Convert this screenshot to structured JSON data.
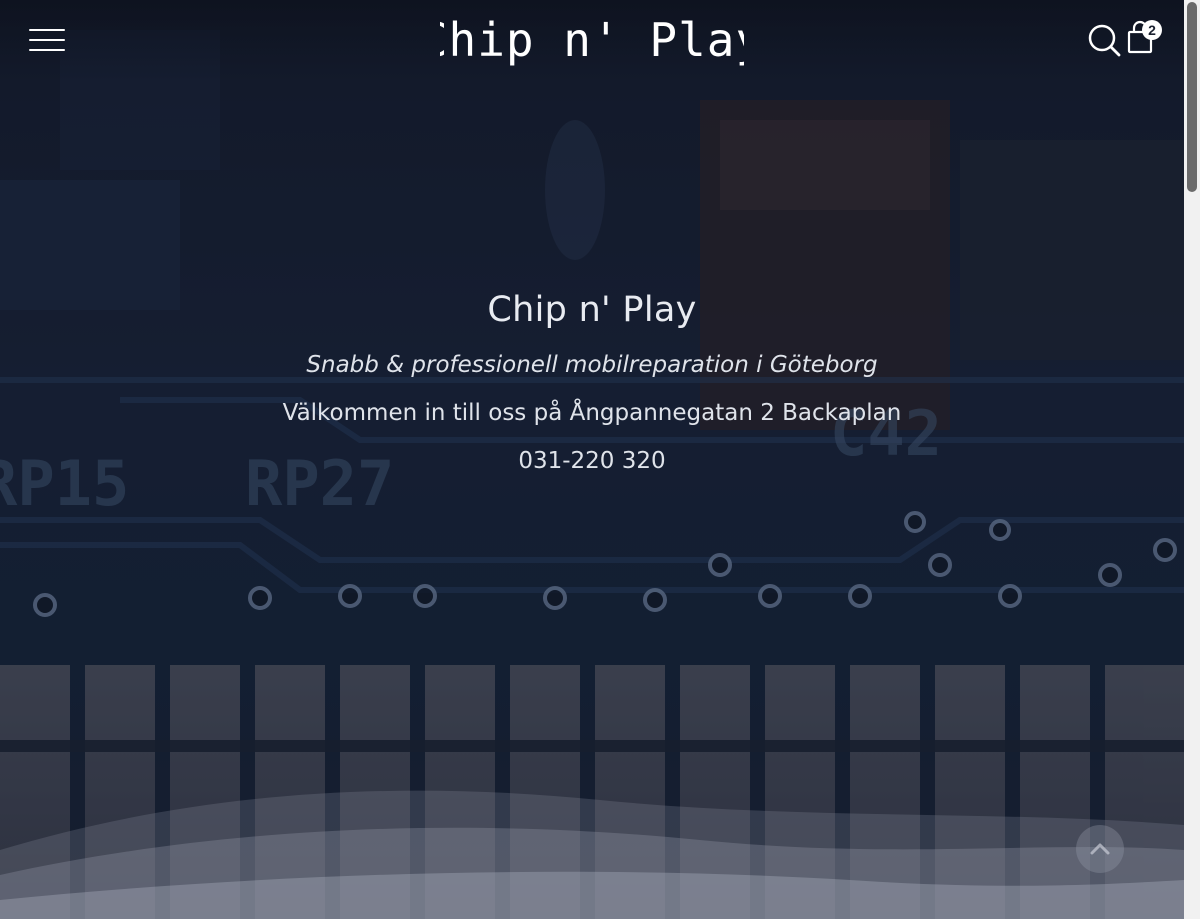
{
  "header": {
    "logo_text": "Chip n' Play",
    "cart_count": "2"
  },
  "hero": {
    "title": "Chip n' Play",
    "tagline": "Snabb & professionell mobilreparation i Göteborg",
    "address": "Välkommen in till oss på Ångpannegatan 2 Backaplan",
    "phone": "031-220 320"
  },
  "background": {
    "board_labels": [
      "RP15",
      "RP27",
      "C42"
    ]
  },
  "icons": {
    "menu": "hamburger-menu-icon",
    "search": "search-icon",
    "cart": "shopping-bag-icon",
    "scroll_top": "chevron-up-icon"
  },
  "colors": {
    "text": "#e8ebf1",
    "background_dark": "#0d1420",
    "scrollbar_thumb": "#6b6b6b"
  }
}
